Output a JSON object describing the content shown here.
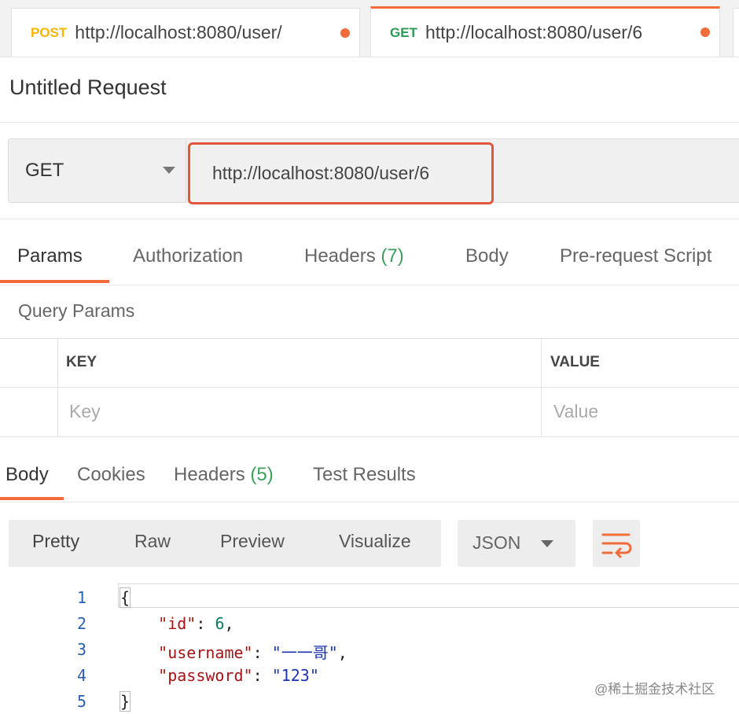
{
  "request_tabs": [
    {
      "method": "POST",
      "url": "http://localhost:8080/user/"
    },
    {
      "method": "GET",
      "url": "http://localhost:8080/user/6"
    }
  ],
  "colors": {
    "accent": "#f26b3a",
    "get": "#2d9a57",
    "post": "#f7b500",
    "count": "#3d9f5b",
    "highlight_border": "#e2563c"
  },
  "request": {
    "title": "Untitled Request",
    "method": "GET",
    "url": "http://localhost:8080/user/6"
  },
  "request_subtabs": {
    "params": "Params",
    "authorization": "Authorization",
    "headers": "Headers",
    "headers_count": "(7)",
    "body": "Body",
    "prerequest": "Pre-request Script"
  },
  "query_params": {
    "label": "Query Params",
    "key_header": "KEY",
    "value_header": "VALUE",
    "key_placeholder": "Key",
    "value_placeholder": "Value"
  },
  "response_tabs": {
    "body": "Body",
    "cookies": "Cookies",
    "headers": "Headers",
    "headers_count": "(5)",
    "test_results": "Test Results"
  },
  "view_modes": {
    "pretty": "Pretty",
    "raw": "Raw",
    "preview": "Preview",
    "visualize": "Visualize",
    "format": "JSON"
  },
  "code": {
    "line_numbers": [
      "1",
      "2",
      "3",
      "4",
      "5"
    ],
    "open_brace": "{",
    "close_brace": "}",
    "id_key": "\"id\"",
    "id_value": "6",
    "username_key": "\"username\"",
    "username_value": "\"一一哥\"",
    "password_key": "\"password\"",
    "password_value": "\"123\""
  },
  "watermark": "@稀土掘金技术社区"
}
